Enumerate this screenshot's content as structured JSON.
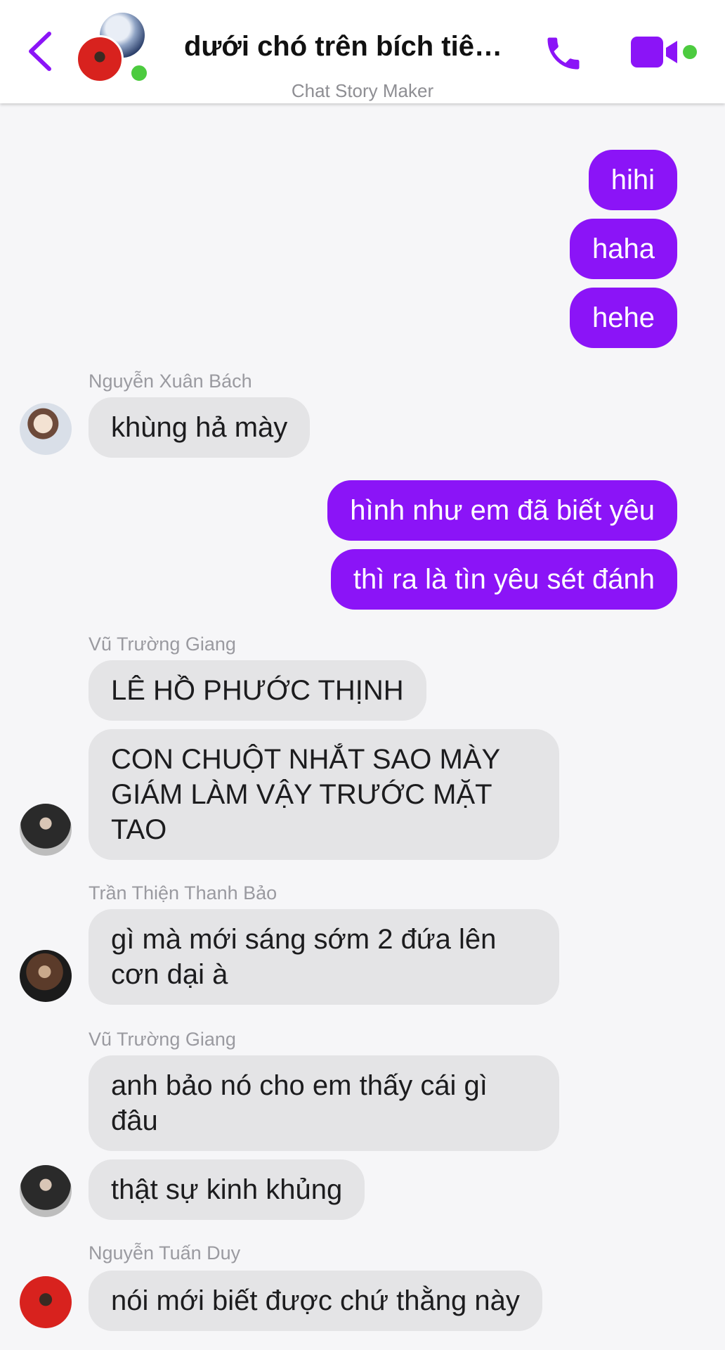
{
  "header": {
    "title": "dưới chó trên bích tiên...",
    "subtitle": "Chat Story Maker",
    "accent_color": "#8b14f7",
    "online_color": "#4ccb3f",
    "icons": [
      "chevron-left-icon",
      "phone-icon",
      "video-camera-icon"
    ]
  },
  "messages": {
    "m1": "hihi",
    "m2": "haha",
    "m3": "hehe",
    "s1": "Nguyễn Xuân Bách",
    "m4": "khùng hả mày",
    "m5": "hình như em đã biết yêu",
    "m6": "thì ra là tìn yêu sét đánh",
    "s2": "Vũ Trường Giang",
    "m7": "LÊ HỒ PHƯỚC THỊNH",
    "m8": "CON CHUỘT NHẮT SAO MÀY GIÁM LÀM VẬY TRƯỚC MẶT TAO",
    "s3": "Trần Thiện Thanh Bảo",
    "m9": "gì mà mới sáng sớm 2 đứa lên cơn dại à",
    "s4": "Vũ Trường Giang",
    "m10": "anh bảo nó cho em thấy cái gì đâu",
    "m11": "thật sự kinh khủng",
    "s5": "Nguyễn Tuấn Duy",
    "m12": "nói mới biết được chứ thằng này"
  }
}
